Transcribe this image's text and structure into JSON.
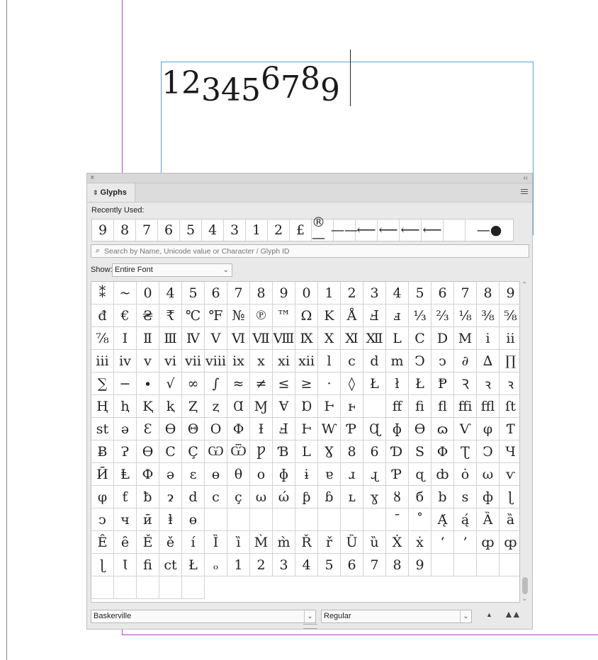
{
  "document": {
    "frame_text": [
      "1",
      "2",
      "3",
      "4",
      "5",
      "6",
      "7",
      "8",
      "9"
    ]
  },
  "panel": {
    "title": "Glyphs",
    "recently_used_label": "Recently Used:",
    "recent": [
      "9",
      "8",
      "7",
      "6",
      "5",
      "4",
      "3",
      "1",
      "2",
      "£",
      "®—",
      "——",
      "⟵",
      "⟵",
      "⟵",
      "⟵",
      "",
      "—●"
    ],
    "search_placeholder": "Search by Name, Unicode value or Character / Glyph ID",
    "show_label": "Show:",
    "show_value": "Entire Font",
    "glyphs": [
      "⁑",
      "~",
      "0",
      "4",
      "5",
      "6",
      "7",
      "8",
      "9",
      "0",
      "1",
      "2",
      "3",
      "4",
      "5",
      "6",
      "7",
      "8",
      "9",
      "đ",
      "€",
      "₴",
      "₹",
      "℃",
      "℉",
      "№",
      "℗",
      "™",
      "Ω",
      "K",
      "Å",
      "Ⅎ",
      "ⅎ",
      "⅓",
      "⅔",
      "⅛",
      "⅜",
      "⅝",
      "⅞",
      "Ⅰ",
      "Ⅱ",
      "Ⅲ",
      "Ⅳ",
      "Ⅴ",
      "Ⅵ",
      "Ⅶ",
      "Ⅷ",
      "Ⅸ",
      "Ⅹ",
      "Ⅺ",
      "Ⅻ",
      "Ⅼ",
      "Ⅽ",
      "Ⅾ",
      "Ⅿ",
      "ⅰ",
      "ⅱ",
      "ⅲ",
      "ⅳ",
      "ⅴ",
      "ⅵ",
      "ⅶ",
      "ⅷ",
      "ⅸ",
      "ⅹ",
      "ⅺ",
      "ⅻ",
      "ⅼ",
      "ⅽ",
      "ⅾ",
      "ⅿ",
      "Ↄ",
      "ↄ",
      "∂",
      "∆",
      "∏",
      "∑",
      "−",
      "∙",
      "√",
      "∞",
      "∫",
      "≈",
      "≠",
      "≤",
      "≥",
      "·",
      "◊",
      "Ł",
      "ł",
      "Ł",
      "Ᵽ",
      "Ꝛ",
      "ꝛ",
      "ꝛ",
      "Ⱨ",
      "ⱨ",
      "Ⱪ",
      "ⱪ",
      "Ⱬ",
      "ⱬ",
      "Ɑ",
      "Ɱ",
      "Ɐ",
      "Ɒ",
      "Ⱶ",
      "ⱶ",
      "",
      "ff",
      "fi",
      "fl",
      "ffi",
      "ffl",
      "ſt",
      "st",
      "ə",
      "Ɛ",
      "Ɵ",
      "Θ",
      "O",
      "Φ",
      "Ɨ",
      "Ⅎ",
      "Ⱶ",
      "Ⱳ",
      "Ƥ",
      "Ɋ",
      "ɸ",
      "Ѳ",
      "ɷ",
      "Ѵ",
      "φ",
      "Ƭ",
      "Ƀ",
      "Ɂ",
      "Ɵ",
      "C",
      "Ç",
      "Ѡ",
      "Ѿ",
      "Ƿ",
      "Ɓ",
      "L",
      "Ɣ",
      "8",
      "6",
      "Ɗ",
      "S",
      "Φ",
      "Ʈ",
      "Ↄ",
      "Ч",
      "Ӣ",
      "Ⱡ",
      "Ф",
      "ə",
      "ɛ",
      "ɵ",
      "θ",
      "o",
      "ɸ",
      "ɨ",
      "ɐ",
      "ɹ",
      "ɻ",
      "Ƥ",
      "ɋ",
      "ȸ",
      "ȯ",
      "ω",
      "ѵ",
      "φ",
      "ƭ",
      "ƀ",
      "ɂ",
      "d",
      "c",
      "ç",
      "ω",
      "ώ",
      "ƥ",
      "ɓ",
      "ʟ",
      "ɣ",
      "ȣ",
      "б",
      "b",
      "s",
      "ф",
      "ɭ",
      "ↄ",
      "ч",
      "ӣ",
      "ⱡ",
      "ɵ",
      "",
      "",
      "",
      "",
      "",
      "",
      "",
      "",
      "ˉ",
      "˚",
      "Ą́",
      "ą́",
      "Ȁ",
      "ȁ",
      "Ȇ",
      "ȇ",
      "Ě",
      "ě",
      "í",
      "Ȉ",
      "ȉ",
      "M̀",
      "m̀",
      "Ř",
      "ř",
      "Ȕ",
      "ȕ",
      "Ẋ",
      "ẋ",
      "‘",
      "’",
      "ȹ",
      "ȹ",
      "ɭ",
      "Ɩ",
      "ﬁ",
      "ct",
      "Ł",
      "ₒ",
      "1",
      "2",
      "3",
      "4",
      "5",
      "6",
      "7",
      "8",
      "9",
      "",
      "",
      "",
      "",
      "",
      "",
      "",
      "",
      ""
    ],
    "selected_glyph_index": 314,
    "font_family": "Baskerville",
    "font_style": "Regular"
  }
}
